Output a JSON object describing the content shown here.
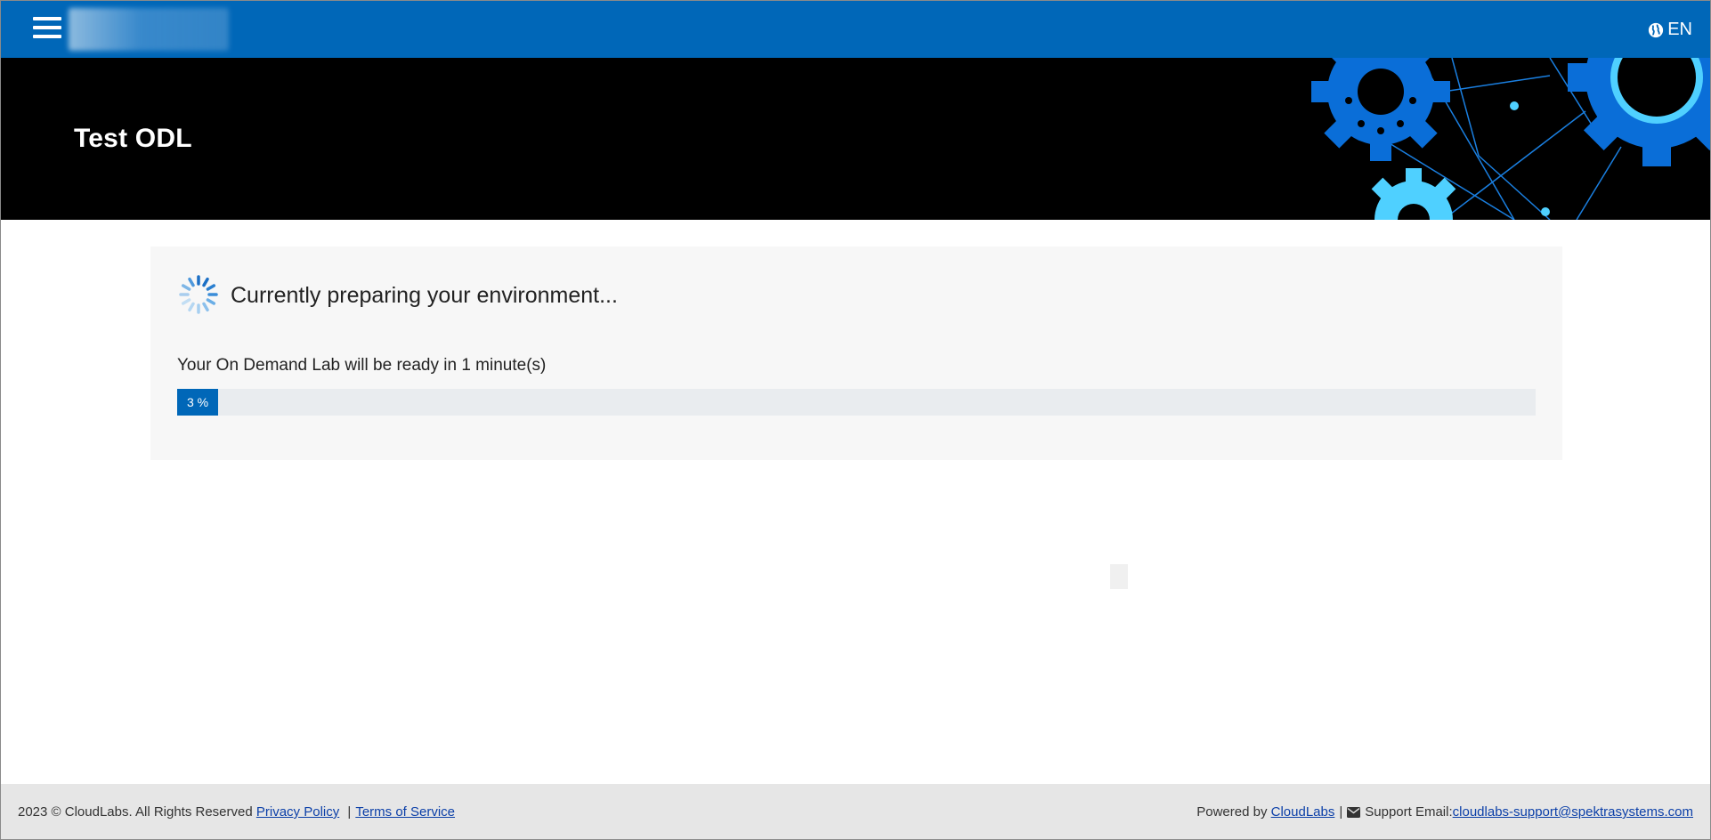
{
  "header": {
    "language": "EN",
    "icons": {
      "menu": "hamburger-icon",
      "language": "globe-icon"
    },
    "colors": {
      "bar": "#0067b8"
    }
  },
  "hero": {
    "title": "Test ODL",
    "art": "gears-network-illustration"
  },
  "main": {
    "status_title": "Currently preparing your environment...",
    "ready_text": "Your On Demand Lab will be ready in 1 minute(s)",
    "progress": {
      "percent": 3,
      "label": "3 %"
    },
    "spinner_icon": "loading-spinner-icon"
  },
  "footer": {
    "copyright": "2023 © CloudLabs. All Rights Reserved",
    "privacy_label": "Privacy Policy",
    "separator": "|",
    "terms_label": "Terms of Service",
    "powered_by": "Powered by",
    "brand_link": "CloudLabs",
    "support_label": "Support Email:",
    "support_email": "cloudlabs-support@spektrasystems.com",
    "icons": {
      "email": "envelope-icon"
    }
  }
}
